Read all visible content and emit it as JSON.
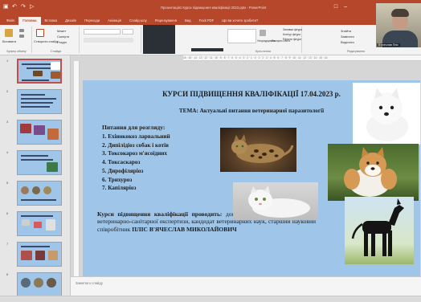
{
  "colors": {
    "accent": "#b7472a",
    "slide_background": "#9fc5e8",
    "ribbon_background": "#f3f3f3"
  },
  "window": {
    "title": "Презентація1 Курси підвищення кваліфікації 2023.pptx - PowerPoint"
  },
  "ribbon": {
    "tabs": [
      "Файл",
      "Головна",
      "Вставка",
      "Дизайн",
      "Переходи",
      "Анімація",
      "Слайд-шоу",
      "Рецензування",
      "Вид",
      "Foxit PDF",
      "Що ви хочете зробити?"
    ],
    "active_tab": 1,
    "groups": {
      "clipboard": "Буфер обміну",
      "slides": "Слайди",
      "drawing": "Креслення",
      "editing": "Редагування"
    },
    "buttons": {
      "paste": "Вставити",
      "new_slide": "Створити слайд",
      "layout": "Макет",
      "reset": "Скинути",
      "section": "Розділ",
      "arrange": "Упорядкувати",
      "quick_styles": "Експрес-стилі",
      "shape_fill": "Заливка фігури",
      "shape_outline": "Контур фігури",
      "shape_effects": "Ефекти фігури",
      "find": "Знайти",
      "replace": "Замінити",
      "select": "Виділити"
    }
  },
  "webcam": {
    "name": "В'ячеслав Пліс"
  },
  "ruler": {
    "ticks": "16 · 15 · 14 · 13 · 12 · 11 · 10 · 9 · 8 · 7 · 6 · 5 · 4 · 3 · 2 · 1 · 0 · 1 · 2 · 3 · 4 · 5 · 6 · 7 · 8 · 9 · 10 · 11 · 12 · 13 · 14 · 15 · 16"
  },
  "slide_panel": {
    "numbers": [
      "1",
      "2",
      "3",
      "4",
      "5",
      "6",
      "7",
      "8"
    ],
    "selected": 1
  },
  "slide": {
    "title": "КУРСИ ПІДВИЩЕННЯ КВАЛІФІКАЦІЇ 17.04.2023 р.",
    "subtitle": "ТЕМА: Актуальні питання ветеринарної паразитології",
    "questions_heading": "Питання для розгляду:",
    "questions": [
      "1.   Ехінококоз ларвальний",
      "2.   Дипілідіоз собак і котів",
      "3.   Токсокароз м'ясоїдних",
      "4.   Токсаскароз",
      "5.   Дирофіляріоз",
      "6.   Трихуроз",
      "7.   Капіляріоз"
    ],
    "lecturer_lead": "Курси підвищення кваліфікації проводить:",
    "lecturer_text": " доцент кафедри паразитології та ветеринарно-санітарної експертизи, кандидат ветеринарних наук, старший науковий співробітник ",
    "lecturer_name": "ПЛІС В'ЯЧЕСЛАВ МИКОЛАЙОВИЧ"
  },
  "notes": {
    "placeholder": "Заметки к слайду"
  }
}
